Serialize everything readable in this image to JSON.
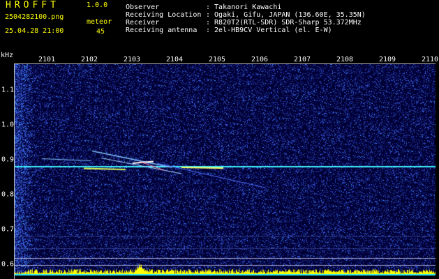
{
  "header": {
    "title": "HROFFT",
    "version": "1.0.0",
    "filename": "2504282100.png",
    "datetime": "25.04.28 21:00",
    "meteor_label": "meteor",
    "meteor_count": "45"
  },
  "info": [
    {
      "key": "Observer",
      "value": ": Takanori Kawachi"
    },
    {
      "key": "Receiving Location",
      "value": ": Ogaki, Gifu, JAPAN (136.60E, 35.35N)"
    },
    {
      "key": "Receiver",
      "value": ": R820T2(RTL-SDR) SDR-Sharp 53.372MHz"
    },
    {
      "key": "Receiving antenna",
      "value": ": 2el-HB9CV Vertical (el. E-W)"
    }
  ],
  "chart_data": {
    "type": "heatmap",
    "ylabel": "kHz",
    "x_ticks": [
      "2101",
      "2102",
      "2103",
      "2104",
      "2105",
      "2106",
      "2107",
      "2108",
      "2109",
      "2110"
    ],
    "y_ticks": [
      "1.1",
      "1.0",
      "0.9",
      "0.8",
      "0.7",
      "0.6"
    ],
    "ylim": [
      0.58,
      1.18
    ],
    "carrier_khz": 0.88,
    "colors": {
      "background": "#00003a",
      "noise": "#3040d0",
      "carrier": "#40f0ff",
      "hot": "#ffff40",
      "activity": "#ffff00"
    }
  }
}
